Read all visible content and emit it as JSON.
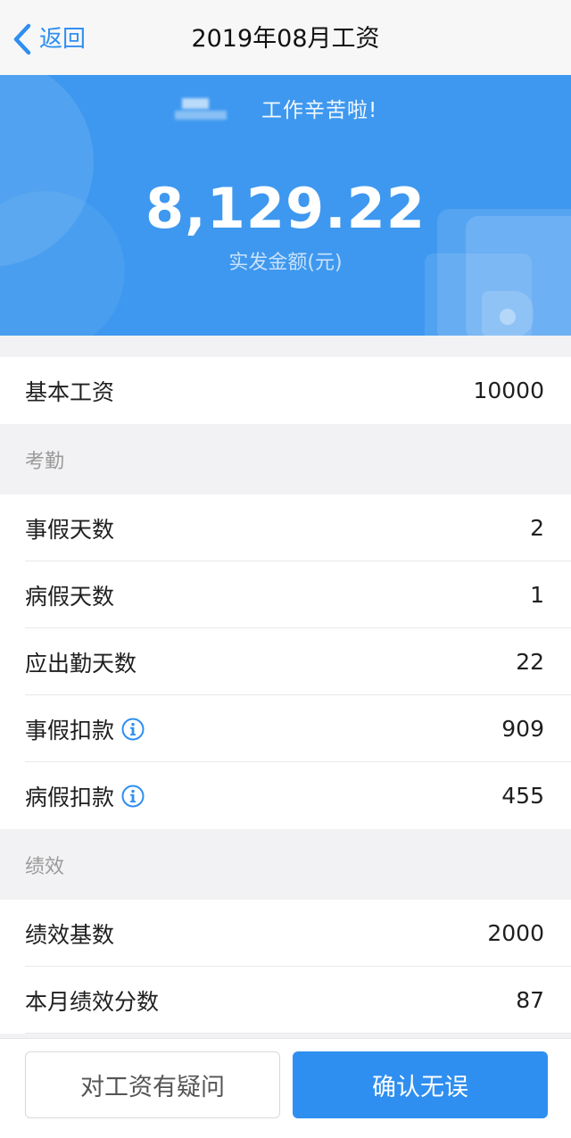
{
  "nav": {
    "back_label": "返回",
    "title": "2019年08月工资"
  },
  "hero": {
    "greeting": "工作辛苦啦!",
    "amount": "8,129.22",
    "amount_caption": "实发金额(元)"
  },
  "base": {
    "label": "基本工资",
    "value": "10000"
  },
  "attendance": {
    "header": "考勤",
    "rows": [
      {
        "label": "事假天数",
        "value": "2"
      },
      {
        "label": "病假天数",
        "value": "1"
      },
      {
        "label": "应出勤天数",
        "value": "22"
      },
      {
        "label": "事假扣款",
        "value": "909",
        "info": true
      },
      {
        "label": "病假扣款",
        "value": "455",
        "info": true
      }
    ]
  },
  "performance": {
    "header": "绩效",
    "rows": [
      {
        "label": "绩效基数",
        "value": "2000"
      },
      {
        "label": "本月绩效分数",
        "value": "87"
      }
    ]
  },
  "actions": {
    "question_label": "对工资有疑问",
    "confirm_label": "确认无误"
  },
  "colors": {
    "accent": "#2f8ff0",
    "hero_background": "#3e98ef",
    "info_icon": "#2f8ff0"
  },
  "icons": {
    "back": "chevron-left-icon",
    "info": "info-circle-icon"
  }
}
